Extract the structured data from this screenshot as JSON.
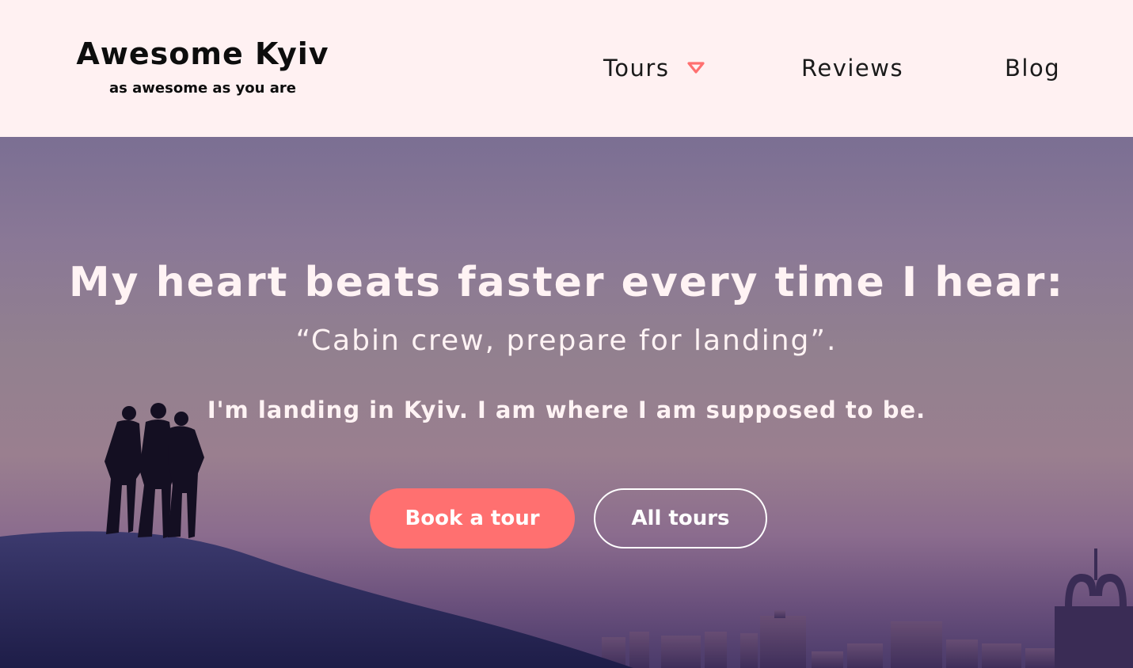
{
  "header": {
    "logo_title": "Awesome Kyiv",
    "logo_tagline": "as awesome as you are",
    "nav": {
      "tours_label": "Tours",
      "reviews_label": "Reviews",
      "blog_label": "Blog"
    },
    "accent_color": "#ff7070",
    "background_color": "#fff1f2"
  },
  "hero": {
    "heading": "My heart beats faster every time I hear:",
    "quote": "“Cabin crew, prepare for landing”.",
    "subheading": "I'm landing in Kyiv. I am where I am supposed to be.",
    "primary_button_label": "Book a tour",
    "secondary_button_label": "All tours"
  },
  "icons": {
    "tours_dropdown": "caret-down-icon"
  }
}
